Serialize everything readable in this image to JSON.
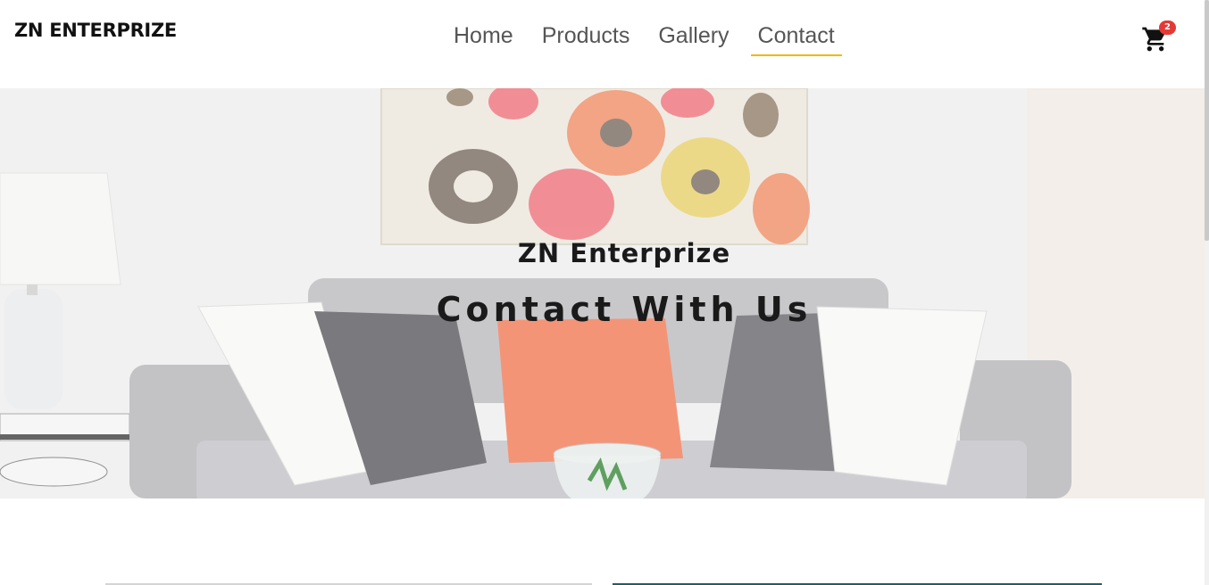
{
  "header": {
    "brand": "ZN ENTERPRIZE",
    "nav": [
      {
        "label": "Home",
        "active": false
      },
      {
        "label": "Products",
        "active": false
      },
      {
        "label": "Gallery",
        "active": false
      },
      {
        "label": "Contact",
        "active": true
      }
    ],
    "cart": {
      "icon": "cart-icon",
      "count": "2"
    }
  },
  "hero": {
    "subtitle": "ZN Enterprize",
    "title": "Contact With Us"
  },
  "colors": {
    "accent_underline": "#f0b90b",
    "badge": "#e53935",
    "pillow_orange": "#f27d5a",
    "sofa_gray": "#b8b8bb"
  }
}
